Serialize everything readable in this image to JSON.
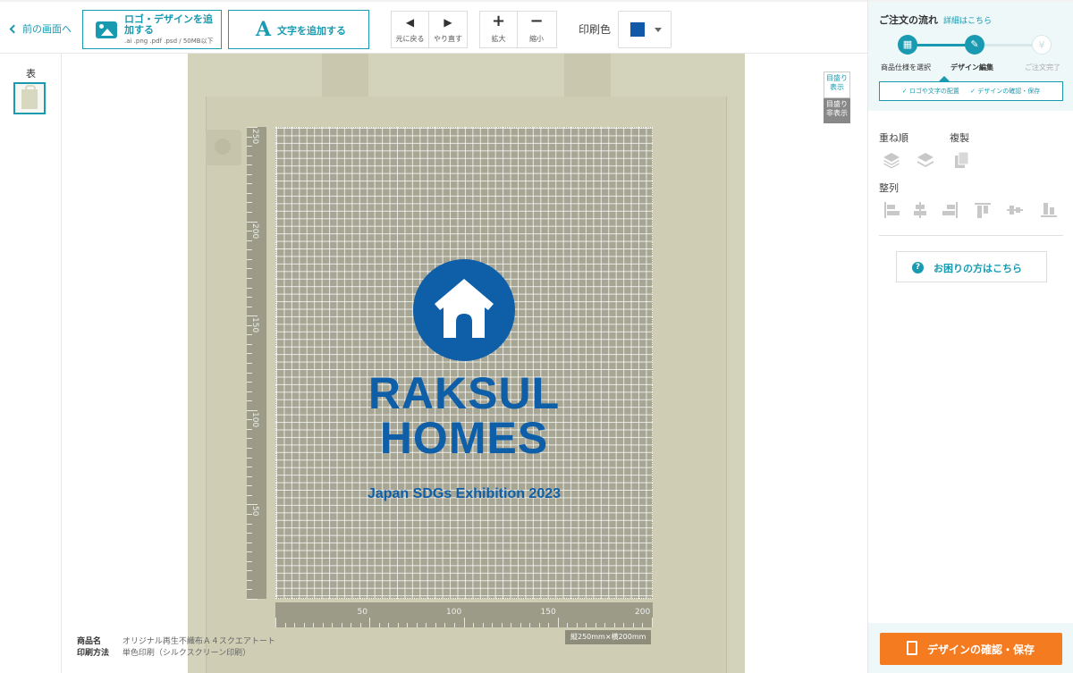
{
  "toolbar": {
    "back_label": "前の画面へ",
    "add_logo_label": "ロゴ・デザインを追加する",
    "add_logo_sub": ".ai .png .pdf .psd / 50MB以下",
    "add_text_label": "文字を追加する",
    "undo_label": "元に戻る",
    "redo_label": "やり直す",
    "zoom_in_label": "拡大",
    "zoom_out_label": "縮小",
    "print_color_label": "印刷色",
    "print_color_value": "#1058a8"
  },
  "sides": {
    "face_label": "表"
  },
  "canvas": {
    "scale_show_label": "目盛り表示",
    "scale_hide_label": "目盛り非表示",
    "ruler_v_labels": [
      "250",
      "200",
      "150",
      "100",
      "50"
    ],
    "ruler_h_labels": [
      "50",
      "100",
      "150",
      "200"
    ],
    "size_tag": "縦250mm×横200mm",
    "design": {
      "line1": "RAKSUL",
      "line2": "HOMES",
      "line3": "Japan SDGs Exhibition 2023",
      "color": "#0f5fa8"
    }
  },
  "product": {
    "name_key": "商品名",
    "name_value": "オリジナル再生不織布Ａ４スクエアトート",
    "method_key": "印刷方法",
    "method_value": "単色印刷（シルクスクリーン印刷）"
  },
  "panel": {
    "flow_title": "ご注文の流れ",
    "flow_detail_link": "詳細はこちら",
    "steps": [
      {
        "label": "商品仕様を選択",
        "icon": "gift-icon",
        "state": "done"
      },
      {
        "label": "デザイン編集",
        "icon": "pencil-icon",
        "state": "current"
      },
      {
        "label": "ご注文完了",
        "icon": "yen-icon",
        "state": "todo"
      }
    ],
    "substep_1": "✓ ロゴや文字の配置",
    "substep_2": "✓ デザインの確認・保存",
    "order_label": "重ね順",
    "duplicate_label": "複製",
    "align_label": "整列",
    "help_label": "お困りの方はこちら",
    "confirm_label": "デザインの確認・保存"
  },
  "colors": {
    "accent": "#1a9ab0",
    "cta": "#f47b20",
    "brand_blue": "#0f5fa8"
  }
}
